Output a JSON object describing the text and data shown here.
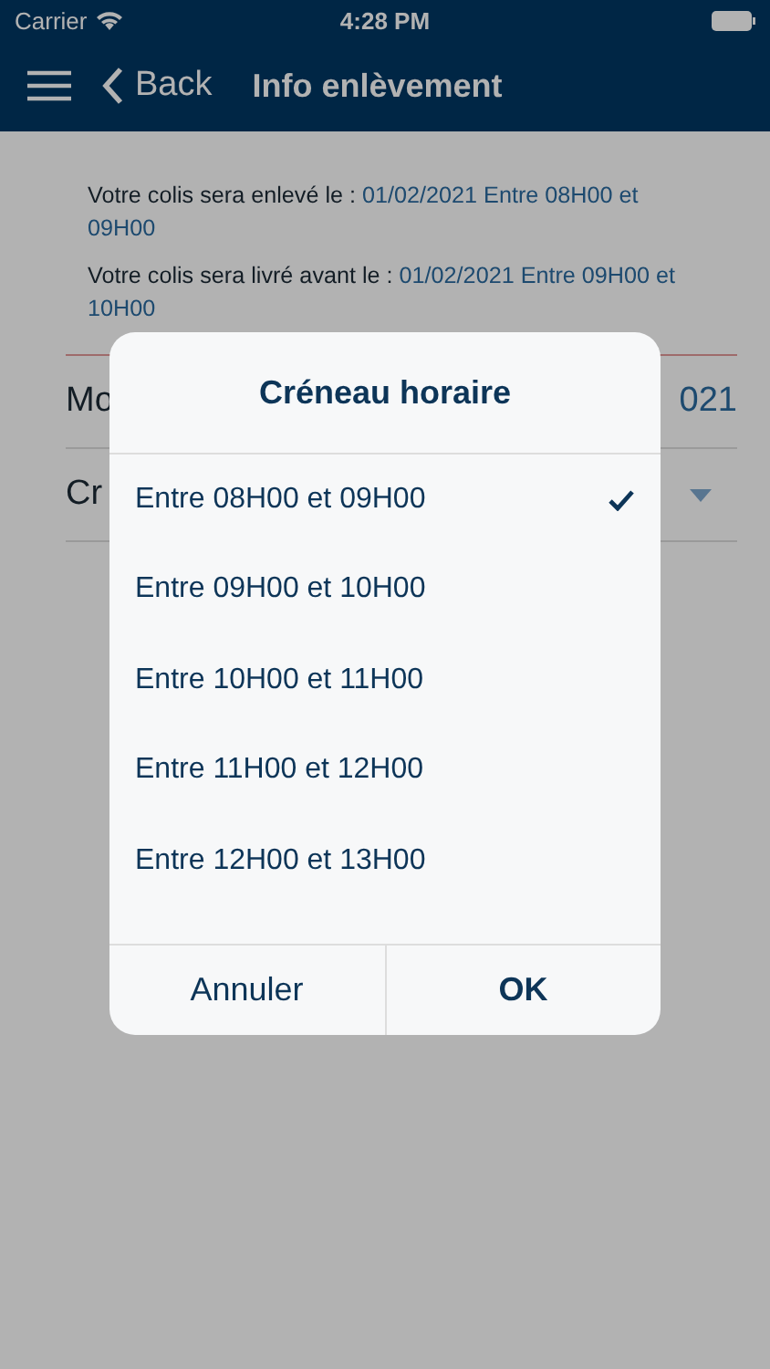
{
  "status_bar": {
    "carrier": "Carrier",
    "time": "4:28 PM"
  },
  "nav": {
    "back": "Back",
    "title": "Info enlèvement"
  },
  "info": [
    {
      "label": "Votre colis sera enlevé le : ",
      "value": "01/02/2021 Entre 08H00 et 09H00"
    },
    {
      "label": "Votre colis sera livré avant le : ",
      "value": "01/02/2021 Entre 09H00 et 10H00"
    }
  ],
  "form_rows": [
    {
      "kind": "value",
      "label": "Mo",
      "value": "021"
    },
    {
      "kind": "dropdown",
      "label": "Cr"
    }
  ],
  "dialog": {
    "title": "Créneau horaire",
    "options": [
      {
        "label": "Entre 08H00 et 09H00",
        "selected": true
      },
      {
        "label": "Entre 09H00 et 10H00",
        "selected": false
      },
      {
        "label": "Entre 10H00 et 11H00",
        "selected": false
      },
      {
        "label": "Entre 11H00 et 12H00",
        "selected": false
      },
      {
        "label": "Entre 12H00 et 13H00",
        "selected": false
      }
    ],
    "buttons": [
      "Annuler",
      "OK"
    ]
  }
}
